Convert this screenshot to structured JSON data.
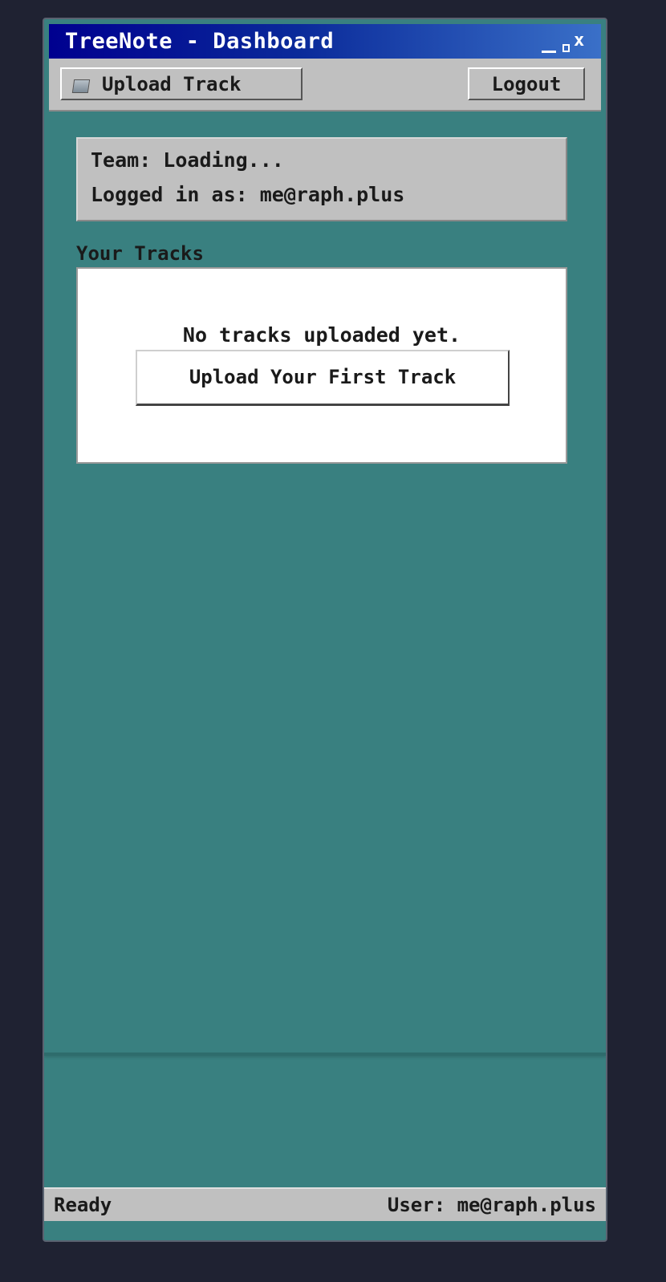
{
  "window": {
    "title": "TreeNote - Dashboard",
    "controls": {
      "minimize": "_",
      "maximize": "□",
      "close": "x"
    }
  },
  "toolbar": {
    "upload_label": "Upload Track",
    "upload_icon": "folder-icon",
    "logout_label": "Logout"
  },
  "info": {
    "team": "Team: Loading...",
    "logged_in": "Logged in as: me@raph.plus"
  },
  "tracks": {
    "section_title": "Your Tracks",
    "empty_message": "No tracks uploaded yet.",
    "first_upload_label": "Upload Your First Track"
  },
  "status": {
    "left": "Ready",
    "right": "User: me@raph.plus"
  },
  "colors": {
    "desktop": "#1f2232",
    "window_bg": "#398080",
    "titlebar_start": "#00008f",
    "titlebar_end": "#3a70c8",
    "panel": "#c0c0c0"
  }
}
